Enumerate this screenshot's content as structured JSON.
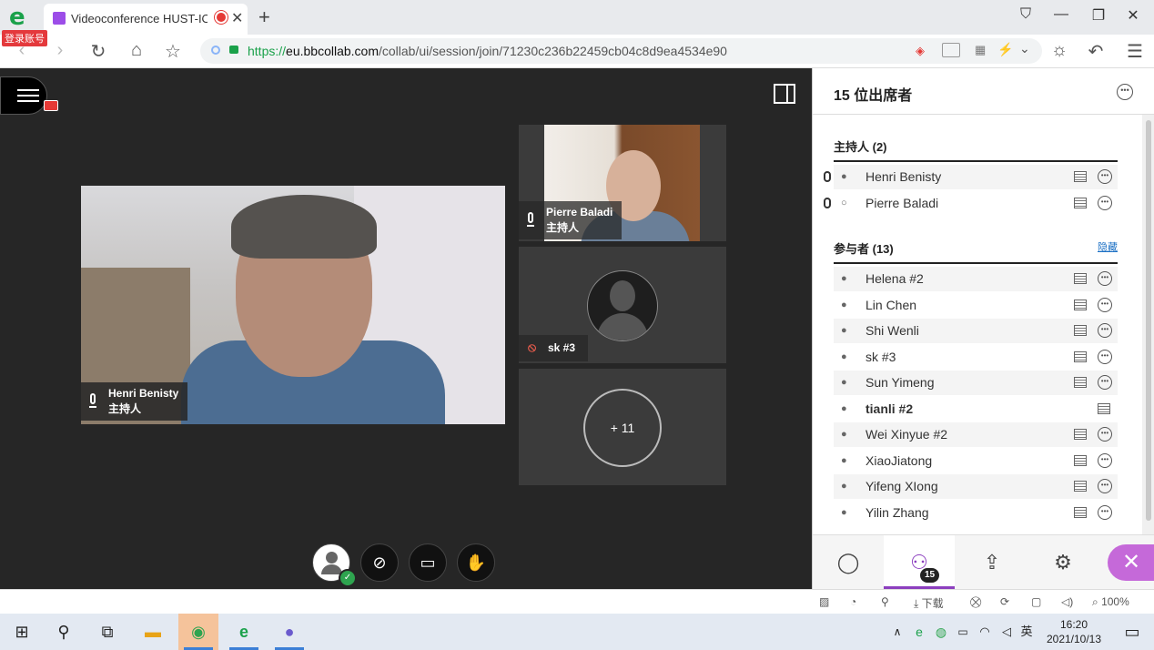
{
  "browser": {
    "badge": "登录账号",
    "tab_title": "Videoconference HUST-IO",
    "tab_close": "✕",
    "new_tab": "+",
    "url_scheme": "https://",
    "url_domain": "eu.bbcollab.com",
    "url_path": "/collab/ui/session/join/71230c236b22459cb04c8d9ea4534e90",
    "window_controls": [
      "⛉",
      "—",
      "❐",
      "✕"
    ]
  },
  "session": {
    "main_speaker": {
      "name": "Henri Benisty",
      "role": "主持人"
    },
    "tiles": [
      {
        "name": "Pierre Baladi",
        "role": "主持人"
      },
      {
        "name": "sk #3"
      }
    ],
    "more_count": "+ 11"
  },
  "panel": {
    "title": "15 位出席者",
    "hosts_header": "主持人 (2)",
    "participants_header": "参与者 (13)",
    "hide_label": "隐藏",
    "hosts": [
      {
        "name": "Henri Benisty"
      },
      {
        "name": "Pierre Baladi"
      }
    ],
    "participants": [
      {
        "name": "Helena #2"
      },
      {
        "name": "Lin Chen"
      },
      {
        "name": "Shi Wenli"
      },
      {
        "name": "sk #3"
      },
      {
        "name": "Sun Yimeng"
      },
      {
        "name": "tianli #2"
      },
      {
        "name": "Wei Xinyue #2"
      },
      {
        "name": "XiaoJiatong"
      },
      {
        "name": "Yifeng XIong"
      },
      {
        "name": "Yilin Zhang"
      }
    ],
    "attendee_badge": "15"
  },
  "statusbar": {
    "download": "下载",
    "zoom": "100%"
  },
  "taskbar": {
    "time": "16:20",
    "date": "2021/10/13",
    "ime": "英"
  }
}
